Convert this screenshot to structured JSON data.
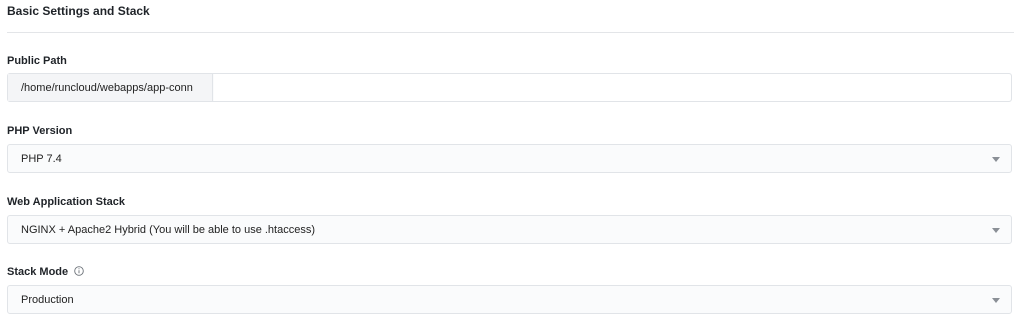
{
  "section": {
    "title": "Basic Settings and Stack"
  },
  "public_path": {
    "label": "Public Path",
    "prefix": "/home/runcloud/webapps/app-conn",
    "value": ""
  },
  "php_version": {
    "label": "PHP Version",
    "selected": "PHP 7.4"
  },
  "web_stack": {
    "label": "Web Application Stack",
    "selected": "NGINX + Apache2 Hybrid (You will be able to use .htaccess)"
  },
  "stack_mode": {
    "label": "Stack Mode",
    "info_icon": "info-circle-icon",
    "selected": "Production"
  }
}
